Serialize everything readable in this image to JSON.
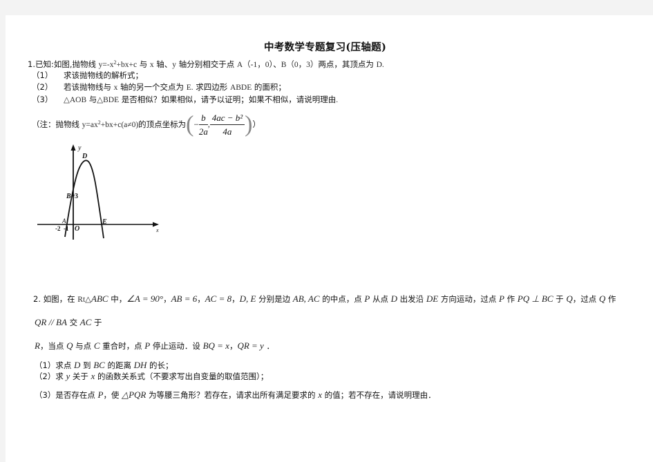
{
  "document": {
    "title": "中考数学专题复习(压轴题)",
    "problem1": {
      "intro_prefix": "1.已知:如图,抛物线 ",
      "equation": "y=-x",
      "equation_sup": "2",
      "equation_rest": "+bx+c",
      "intro_mid1": " 与 ",
      "x_axis": "x",
      "intro_mid2": " 轴、",
      "y_axis": "y",
      "intro_mid3": " 轴分别相交于点 ",
      "point_a": "A（-1，0）",
      "intro_mid4": "、",
      "point_b": "B（0，3）",
      "intro_suffix": "两点，其顶点为 ",
      "vertex": "D.",
      "questions": [
        {
          "num": "（1）",
          "parts": [
            "求该抛物线的解析式；"
          ]
        },
        {
          "num": "（2）",
          "parts": [
            "若该抛物线与 ",
            "x",
            " 轴的另一个交点为 ",
            "E.",
            " 求四边形 ",
            "ABDE",
            " 的面积；"
          ]
        },
        {
          "num": "（3）",
          "parts": [
            "△AOB",
            " 与",
            "△BDE",
            " 是否相似？如果相似，请予以证明；如果不相似，请说明理由",
            "."
          ]
        }
      ],
      "note_prefix": "（注：抛物线 ",
      "note_eq": "y=ax",
      "note_eq_sup": "2",
      "note_eq_rest": "+bx+c(a≠0)",
      "note_mid": "的顶点坐标为",
      "frac1_minus": "−",
      "frac1_top": "b",
      "frac1_bot": "2a",
      "frac_sep": ",",
      "frac2_top": "4ac − b²",
      "frac2_bot": "4a",
      "note_suffix": "）"
    },
    "graph": {
      "y_label": "y",
      "x_label": "x",
      "label_d": "D",
      "label_b": "B",
      "label_3": "3",
      "label_a": "A",
      "label_neg2": "-2",
      "label_neg1": "-1",
      "label_o": "O",
      "label_e": "E"
    },
    "problem2": {
      "line1": [
        {
          "t": "2.  如图，在 ",
          "s": "cn"
        },
        {
          "t": "Rt△",
          "s": "m"
        },
        {
          "t": "ABC",
          "s": "mi"
        },
        {
          "t": " 中，",
          "s": "cn"
        },
        {
          "t": "∠A = 90°",
          "s": "mi"
        },
        {
          "t": "，",
          "s": "cn"
        },
        {
          "t": "AB = 6",
          "s": "mi"
        },
        {
          "t": "，",
          "s": "cn"
        },
        {
          "t": "AC = 8",
          "s": "mi"
        },
        {
          "t": "，",
          "s": "cn"
        },
        {
          "t": "D,  E",
          "s": "mi"
        },
        {
          "t": " 分别是边 ",
          "s": "cn"
        },
        {
          "t": "AB,  AC",
          "s": "mi"
        },
        {
          "t": " 的中点，点 ",
          "s": "cn"
        },
        {
          "t": "P",
          "s": "mi"
        },
        {
          "t": " 从点 ",
          "s": "cn"
        },
        {
          "t": "D",
          "s": "mi"
        },
        {
          "t": " 出发沿 ",
          "s": "cn"
        },
        {
          "t": "DE",
          "s": "mi"
        },
        {
          "t": " 方向运动，过点 ",
          "s": "cn"
        },
        {
          "t": "P",
          "s": "mi"
        },
        {
          "t": " 作 ",
          "s": "cn"
        },
        {
          "t": "PQ ⊥ BC",
          "s": "mi"
        },
        {
          "t": " 于 ",
          "s": "cn"
        },
        {
          "t": "Q",
          "s": "mi"
        },
        {
          "t": "，过点 ",
          "s": "cn"
        },
        {
          "t": "Q",
          "s": "mi"
        },
        {
          "t": " 作",
          "s": "cn"
        }
      ],
      "line2": [
        {
          "t": "QR // BA",
          "s": "mi"
        },
        {
          "t": " 交 ",
          "s": "cn"
        },
        {
          "t": "AC",
          "s": "mi"
        },
        {
          "t": " 于",
          "s": "cn"
        }
      ],
      "line3": [
        {
          "t": "R",
          "s": "mi"
        },
        {
          "t": "，当点 ",
          "s": "cn"
        },
        {
          "t": "Q",
          "s": "mi"
        },
        {
          "t": " 与点 ",
          "s": "cn"
        },
        {
          "t": "C",
          "s": "mi"
        },
        {
          "t": " 重合时，点 ",
          "s": "cn"
        },
        {
          "t": "P",
          "s": "mi"
        },
        {
          "t": " 停止运动．设 ",
          "s": "cn"
        },
        {
          "t": "BQ = x",
          "s": "mi"
        },
        {
          "t": "，",
          "s": "cn"
        },
        {
          "t": "QR = y",
          "s": "mi"
        },
        {
          "t": " ．",
          "s": "cn"
        }
      ],
      "q1": [
        {
          "t": "（1）求点 ",
          "s": "cn"
        },
        {
          "t": "D",
          "s": "mi"
        },
        {
          "t": " 到 ",
          "s": "cn"
        },
        {
          "t": "BC",
          "s": "mi"
        },
        {
          "t": " 的距离 ",
          "s": "cn"
        },
        {
          "t": "DH",
          "s": "mi"
        },
        {
          "t": " 的长；",
          "s": "cn"
        }
      ],
      "q2": [
        {
          "t": "（2）求 ",
          "s": "cn"
        },
        {
          "t": "y",
          "s": "mi"
        },
        {
          "t": " 关于 ",
          "s": "cn"
        },
        {
          "t": "x",
          "s": "mi"
        },
        {
          "t": " 的函数关系式（不要求写出自变量的取值范围）；",
          "s": "cn"
        }
      ],
      "q3": [
        {
          "t": "（3）是否存在点 ",
          "s": "cn"
        },
        {
          "t": "P",
          "s": "mi"
        },
        {
          "t": "，使 ",
          "s": "cn"
        },
        {
          "t": "△PQR",
          "s": "mi"
        },
        {
          "t": " 为等腰三角形？若存在，请求出所有满足要求的 ",
          "s": "cn"
        },
        {
          "t": "x",
          "s": "mi"
        },
        {
          "t": " 的值；若不存在，请说明理由．",
          "s": "cn"
        }
      ]
    }
  }
}
